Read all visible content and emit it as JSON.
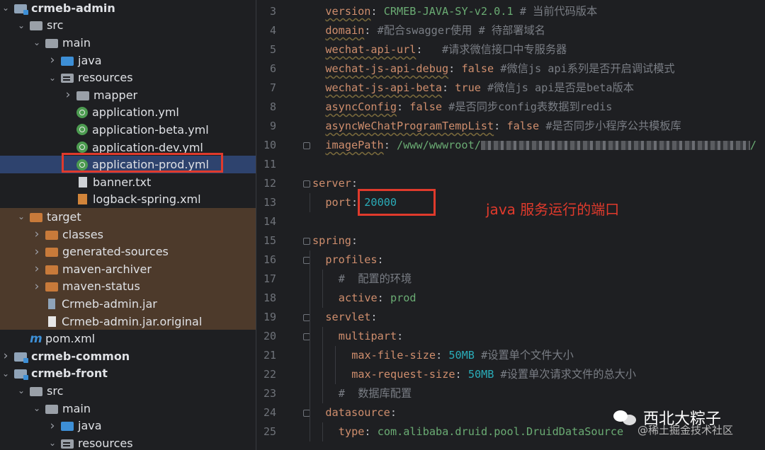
{
  "tree": [
    {
      "label": "crmeb-admin",
      "depth": 0,
      "chevron": "down",
      "icon": "module",
      "bold": true
    },
    {
      "label": "src",
      "depth": 1,
      "chevron": "down",
      "icon": "folder"
    },
    {
      "label": "main",
      "depth": 2,
      "chevron": "down",
      "icon": "folder"
    },
    {
      "label": "java",
      "depth": 3,
      "chevron": "right",
      "icon": "folder-blue"
    },
    {
      "label": "resources",
      "depth": 3,
      "chevron": "down",
      "icon": "res"
    },
    {
      "label": "mapper",
      "depth": 4,
      "chevron": "right",
      "icon": "folder"
    },
    {
      "label": "application.yml",
      "depth": 4,
      "chevron": "",
      "icon": "yml"
    },
    {
      "label": "application-beta.yml",
      "depth": 4,
      "chevron": "",
      "icon": "yml"
    },
    {
      "label": "application-dev.yml",
      "depth": 4,
      "chevron": "",
      "icon": "yml"
    },
    {
      "label": "application-prod.yml",
      "depth": 4,
      "chevron": "",
      "icon": "yml",
      "selected": true
    },
    {
      "label": "banner.txt",
      "depth": 4,
      "chevron": "",
      "icon": "txt"
    },
    {
      "label": "logback-spring.xml",
      "depth": 4,
      "chevron": "",
      "icon": "xml"
    },
    {
      "label": "target",
      "depth": 1,
      "chevron": "down",
      "icon": "folder-orange",
      "target": true
    },
    {
      "label": "classes",
      "depth": 2,
      "chevron": "right",
      "icon": "folder-orange",
      "target": true
    },
    {
      "label": "generated-sources",
      "depth": 2,
      "chevron": "right",
      "icon": "folder-orange",
      "target": true
    },
    {
      "label": "maven-archiver",
      "depth": 2,
      "chevron": "right",
      "icon": "folder-orange",
      "target": true
    },
    {
      "label": "maven-status",
      "depth": 2,
      "chevron": "right",
      "icon": "folder-orange",
      "target": true
    },
    {
      "label": "Crmeb-admin.jar",
      "depth": 2,
      "chevron": "",
      "icon": "jar",
      "target": true
    },
    {
      "label": "Crmeb-admin.jar.original",
      "depth": 2,
      "chevron": "",
      "icon": "file",
      "target": true
    },
    {
      "label": "pom.xml",
      "depth": 1,
      "chevron": "",
      "icon": "m"
    },
    {
      "label": "crmeb-common",
      "depth": 0,
      "chevron": "right",
      "icon": "module",
      "bold": true
    },
    {
      "label": "crmeb-front",
      "depth": 0,
      "chevron": "down",
      "icon": "module",
      "bold": true
    },
    {
      "label": "src",
      "depth": 1,
      "chevron": "down",
      "icon": "folder"
    },
    {
      "label": "main",
      "depth": 2,
      "chevron": "down",
      "icon": "folder"
    },
    {
      "label": "java",
      "depth": 3,
      "chevron": "right",
      "icon": "folder-blue"
    },
    {
      "label": "resources",
      "depth": 3,
      "chevron": "down",
      "icon": "res"
    }
  ],
  "code": [
    {
      "num": "3",
      "indent": 1,
      "key": "version",
      "value": "CRMEB-JAVA-SY-v2.0.1",
      "vtype": "str",
      "comment": "# 当前代码版本",
      "squiggle": true
    },
    {
      "num": "4",
      "indent": 1,
      "key": "domain",
      "value": "",
      "comment": "#配合swagger使用 # 待部署域名",
      "squiggle": true
    },
    {
      "num": "5",
      "indent": 1,
      "key": "wechat-api-url",
      "value": " ",
      "comment": "#请求微信接口中专服务器",
      "squiggle": true
    },
    {
      "num": "6",
      "indent": 1,
      "key": "wechat-js-api-debug",
      "value": "false",
      "vtype": "bool",
      "comment": "#微信js api系列是否开启调试模式",
      "squiggle": true
    },
    {
      "num": "7",
      "indent": 1,
      "key": "wechat-js-api-beta",
      "value": "true",
      "vtype": "bool",
      "comment": "#微信js api是否是beta版本",
      "squiggle": true
    },
    {
      "num": "8",
      "indent": 1,
      "key": "asyncConfig",
      "value": "false",
      "vtype": "bool",
      "comment": "#是否同步config表数据到redis",
      "squiggle": true
    },
    {
      "num": "9",
      "indent": 1,
      "key": "asyncWeChatProgramTempList",
      "value": "false",
      "vtype": "bool",
      "comment": "#是否同步小程序公共模板库",
      "squiggle": true
    },
    {
      "num": "10",
      "indent": 1,
      "key": "imagePath",
      "value": "/www/wwwroot/",
      "vtype": "str",
      "blur": true,
      "tail": "/",
      "squiggle": true,
      "fold": true
    },
    {
      "num": "11",
      "indent": 0,
      "key": "",
      "value": "",
      "comment": ""
    },
    {
      "num": "12",
      "indent": 0,
      "key": "server",
      "value": "",
      "comment": "",
      "fold": true
    },
    {
      "num": "13",
      "indent": 1,
      "key": "port",
      "value": "20000",
      "vtype": "num",
      "comment": ""
    },
    {
      "num": "14",
      "indent": 0,
      "key": "",
      "value": "",
      "comment": ""
    },
    {
      "num": "15",
      "indent": 0,
      "key": "spring",
      "value": "",
      "comment": "",
      "fold": true
    },
    {
      "num": "16",
      "indent": 1,
      "key": "profiles",
      "value": "",
      "comment": "",
      "fold": true
    },
    {
      "num": "17",
      "indent": 2,
      "key": "",
      "value": "",
      "comment": "#  配置的环境"
    },
    {
      "num": "18",
      "indent": 2,
      "key": "active",
      "value": "prod",
      "vtype": "str",
      "comment": ""
    },
    {
      "num": "19",
      "indent": 1,
      "key": "servlet",
      "value": "",
      "comment": "",
      "fold": true
    },
    {
      "num": "20",
      "indent": 2,
      "key": "multipart",
      "value": "",
      "comment": "",
      "fold": true
    },
    {
      "num": "21",
      "indent": 3,
      "key": "max-file-size",
      "value": "50MB",
      "vtype": "num",
      "comment": "#设置单个文件大小"
    },
    {
      "num": "22",
      "indent": 3,
      "key": "max-request-size",
      "value": "50MB",
      "vtype": "num",
      "comment": "#设置单次请求文件的总大小"
    },
    {
      "num": "23",
      "indent": 2,
      "key": "",
      "value": "",
      "comment": "#  数据库配置"
    },
    {
      "num": "24",
      "indent": 1,
      "key": "datasource",
      "value": "",
      "comment": "",
      "fold": true
    },
    {
      "num": "25",
      "indent": 2,
      "key": "type",
      "value": "com.alibaba.druid.pool.DruidDataSource",
      "vtype": "str",
      "comment": ""
    }
  ],
  "annotation": "java 服务运行的端口",
  "watermark": {
    "name": "西北大粽子",
    "site": "@稀土掘金技术社区"
  },
  "colors": {
    "highlight": "#e03a2c",
    "key": "#cf8e6d",
    "string": "#6aab73",
    "number": "#2aacb8",
    "comment": "#7a7e85"
  }
}
